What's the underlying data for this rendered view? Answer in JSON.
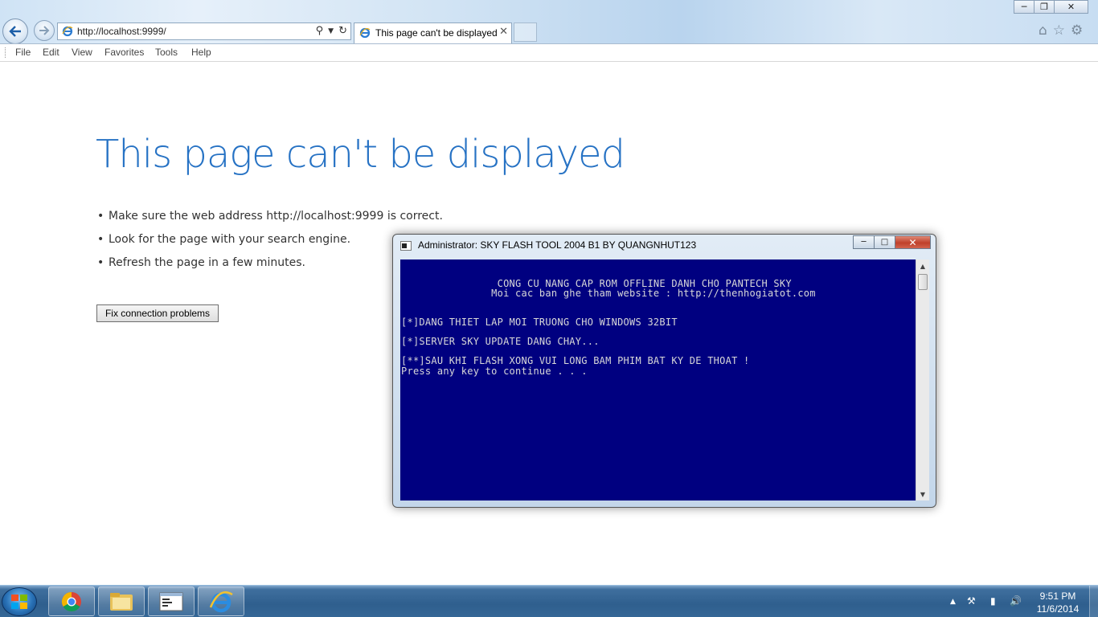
{
  "browser": {
    "address": {
      "url": "http://localhost:9999/"
    },
    "tab": {
      "title": "This page can't be displayed"
    },
    "menu": [
      "File",
      "Edit",
      "View",
      "Favorites",
      "Tools",
      "Help"
    ]
  },
  "error_page": {
    "title": "This page can't be displayed",
    "bullets": [
      "Make sure the web address http://localhost:9999 is correct.",
      "Look for the page with your search engine.",
      "Refresh the page in a few minutes."
    ],
    "fix_button": "Fix connection problems"
  },
  "console": {
    "title": "Administrator:  SKY FLASH TOOL 2004 B1 BY QUANGNHUT123",
    "bg_color": "#000080",
    "lines": [
      "                CONG CU NANG CAP ROM OFFLINE DANH CHO PANTECH SKY",
      "               Moi cac ban ghe tham website : http://thenhogiatot.com",
      "[*]DANG THIET LAP MOI TRUONG CHO WINDOWS 32BIT",
      "[*]SERVER SKY UPDATE DANG CHAY...",
      "[**]SAU KHI FLASH XONG VUI LONG BAM PHIM BAT KY DE THOAT !",
      "Press any key to continue . . ."
    ]
  },
  "taskbar": {
    "apps": [
      "chrome-icon",
      "file-explorer-icon",
      "console-icon",
      "internet-explorer-icon"
    ],
    "clock": {
      "time": "9:51 PM",
      "date": "11/6/2014"
    }
  },
  "colors": {
    "accent": "#2672c4",
    "taskbar": "#2f5f8e"
  }
}
